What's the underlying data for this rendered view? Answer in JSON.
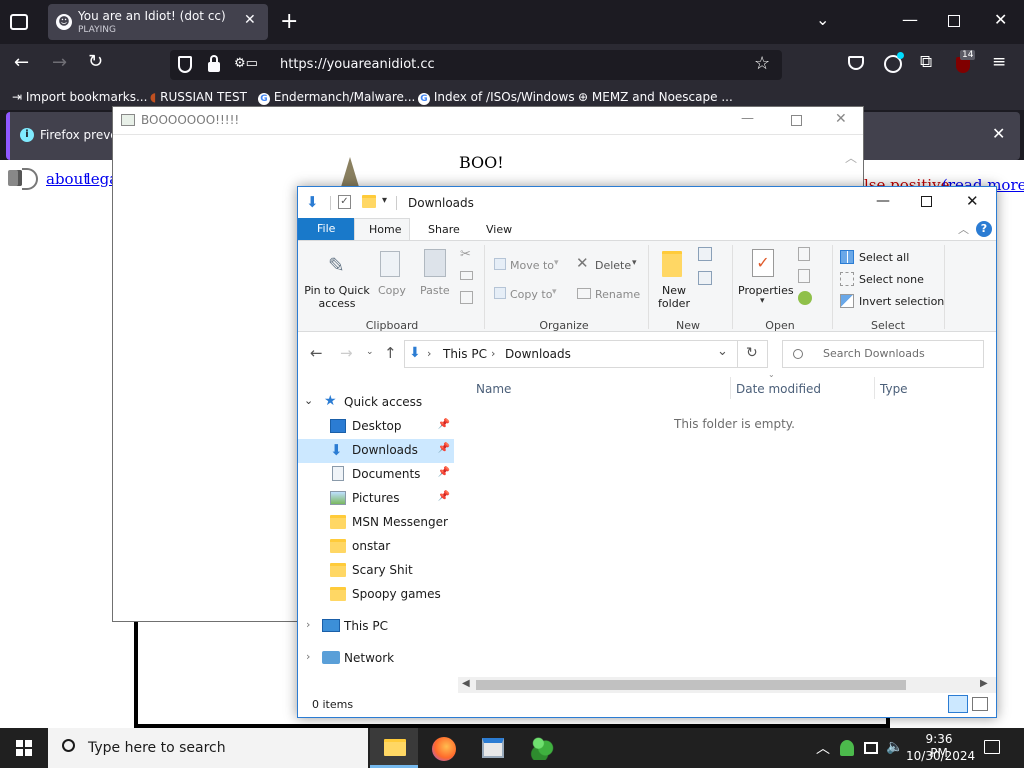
{
  "browser": {
    "tab_title": "You are an Idiot! (dot cc)",
    "tab_status": "PLAYING",
    "url": "https://youareanidiot.cc",
    "extension_badge": "14",
    "bookmarks": [
      "Import bookmarks...",
      "RUSSIAN TEST",
      "Endermanch/Malware...",
      "Index of /ISOs/Windows",
      "MEMZ and Noescape ..."
    ],
    "notification_text": "Firefox prever"
  },
  "webpage": {
    "link_about": "about",
    "link_legal": "lega",
    "text_false_positive": "lse positive",
    "link_read_more": "(read more)"
  },
  "popup": {
    "title": "BOOOOOOO!!!!!",
    "boo_text": "BOO!"
  },
  "explorer": {
    "title": "Downloads",
    "tabs": {
      "file": "File",
      "home": "Home",
      "share": "Share",
      "view": "View"
    },
    "ribbon": {
      "pin": "Pin to Quick access",
      "copy": "Copy",
      "paste": "Paste",
      "move_to": "Move to",
      "copy_to": "Copy to",
      "delete": "Delete",
      "rename": "Rename",
      "new_folder": "New folder",
      "properties": "Properties",
      "select_all": "Select all",
      "select_none": "Select none",
      "invert_selection": "Invert selection",
      "groups": {
        "clipboard": "Clipboard",
        "organize": "Organize",
        "new": "New",
        "open": "Open",
        "select": "Select"
      }
    },
    "breadcrumb": {
      "root": "This PC",
      "current": "Downloads"
    },
    "search_placeholder": "Search Downloads",
    "columns": {
      "name": "Name",
      "date": "Date modified",
      "type": "Type"
    },
    "empty_text": "This folder is empty.",
    "nav": {
      "quick_access": "Quick access",
      "desktop": "Desktop",
      "downloads": "Downloads",
      "documents": "Documents",
      "pictures": "Pictures",
      "msn": "MSN Messenger",
      "onstar": "onstar",
      "scary": "Scary Shit",
      "spoopy": "Spoopy games",
      "this_pc": "This PC",
      "network": "Network"
    },
    "status": "0 items"
  },
  "taskbar": {
    "search_placeholder": "Type here to search",
    "time": "9:36 PM",
    "date": "10/30/2024"
  },
  "colors": {
    "accent": "#2b7cd3",
    "file_tab": "#1979ca",
    "firefox_purple": "#9059ff"
  }
}
